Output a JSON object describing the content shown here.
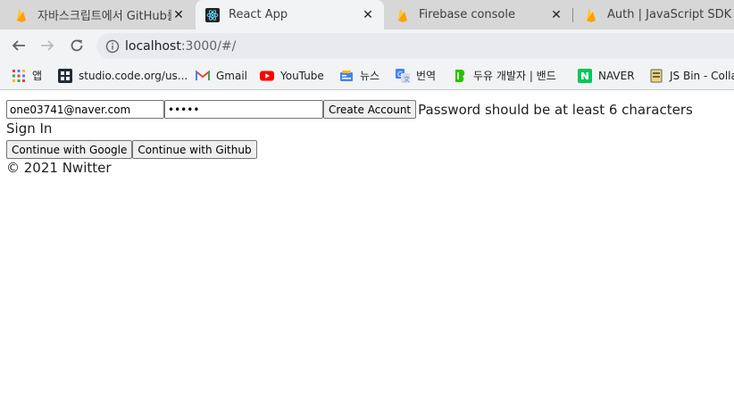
{
  "tabs": [
    {
      "title": "자바스크립트에서 GitHub를",
      "favicon": "firebase-icon",
      "close": "✕"
    },
    {
      "title": "React App",
      "favicon": "react-icon",
      "close": "✕",
      "active": true
    },
    {
      "title": "Firebase console",
      "favicon": "firebase-icon",
      "close": "✕"
    },
    {
      "title": "Auth | JavaScript SDK  |  F",
      "favicon": "firebase-icon"
    }
  ],
  "toolbar": {
    "url_host": "localhost",
    "url_rest": ":3000/#/"
  },
  "bookmarks": [
    {
      "label": "앱",
      "icon": "apps-grid-icon"
    },
    {
      "label": "studio.code.org/us...",
      "icon": "code-org-icon"
    },
    {
      "label": "Gmail",
      "icon": "gmail-icon"
    },
    {
      "label": "YouTube",
      "icon": "youtube-icon"
    },
    {
      "label": "뉴스",
      "icon": "news-icon"
    },
    {
      "label": "번역",
      "icon": "translate-icon"
    },
    {
      "label": "두유 개발자 | 밴드",
      "icon": "band-icon"
    },
    {
      "label": "NAVER",
      "icon": "naver-icon"
    },
    {
      "label": "JS Bin - Colla",
      "icon": "jsbin-icon"
    }
  ],
  "form": {
    "email_value": "one03741@naver.com",
    "password_value": "•••••",
    "submit_label": "Create Account",
    "error_text": "Password should be at least 6 characters",
    "toggle_text": "Sign In",
    "google_label": "Continue with Google",
    "github_label": "Continue with Github",
    "footer_text": "© 2021 Nwitter"
  },
  "colors": {
    "tabstrip_bg": "#d7d7d7",
    "toolbar_bg": "#f1f3f4",
    "firebase_yellow": "#ffa000",
    "react_blue": "#61dafb"
  }
}
